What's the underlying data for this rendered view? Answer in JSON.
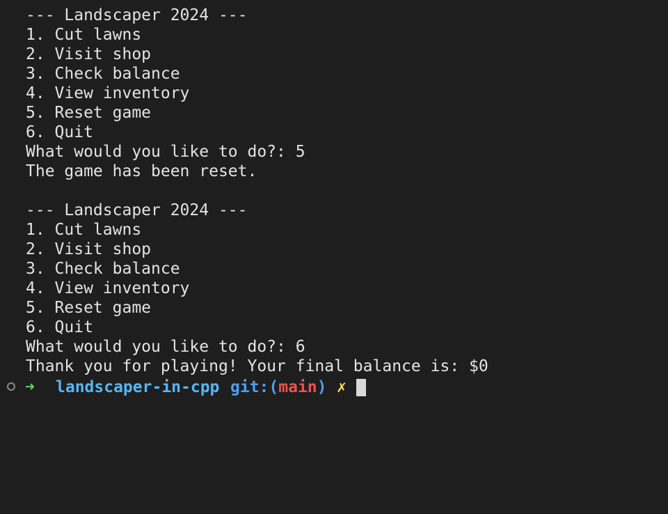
{
  "terminal": {
    "lines": [
      "--- Landscaper 2024 ---",
      "1. Cut lawns",
      "2. Visit shop",
      "3. Check balance",
      "4. View inventory",
      "5. Reset game",
      "6. Quit",
      "What would you like to do?: 5",
      "The game has been reset.",
      "",
      "--- Landscaper 2024 ---",
      "1. Cut lawns",
      "2. Visit shop",
      "3. Check balance",
      "4. View inventory",
      "5. Reset game",
      "6. Quit",
      "What would you like to do?: 6",
      "Thank you for playing! Your final balance is: $0"
    ]
  },
  "prompt": {
    "arrow": "➜",
    "directory": "landscaper-in-cpp",
    "git_label": "git:",
    "open_paren": "(",
    "branch": "main",
    "close_paren": ")",
    "dirty_marker": "✗"
  },
  "colors": {
    "background": "#1e1e1e",
    "text": "#e3e3e3",
    "arrow": "#5fd35f",
    "directory": "#56b6f2",
    "git": "#4e9ef0",
    "branch": "#e8554e",
    "dirty": "#f5e552"
  }
}
